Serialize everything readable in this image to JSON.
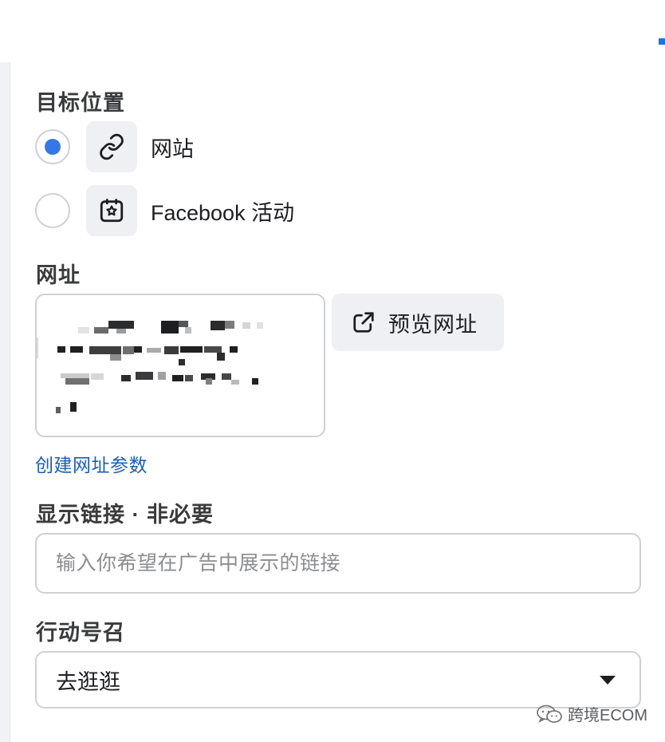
{
  "destination": {
    "title": "目标位置",
    "options": [
      {
        "label": "网站",
        "icon": "link-icon",
        "selected": true
      },
      {
        "label": "Facebook 活动",
        "icon": "event-star-icon",
        "selected": false
      }
    ]
  },
  "url": {
    "title": "网址",
    "value_state": "pixelated",
    "preview_button": {
      "label": "预览网址",
      "icon": "external-link-icon"
    },
    "create_params_link": "创建网址参数"
  },
  "display_link": {
    "title": "显示链接 · 非必要",
    "placeholder": "输入你希望在广告中展示的链接"
  },
  "cta": {
    "title": "行动号召",
    "selected": "去逛逛",
    "icon": "caret-down-icon"
  },
  "watermark": {
    "text": "跨境ECOM",
    "icon": "wechat-icon"
  },
  "colors": {
    "accent": "#3578e5",
    "link": "#1a5fb4",
    "border": "#ced0d4",
    "tile": "#eef0f3"
  }
}
